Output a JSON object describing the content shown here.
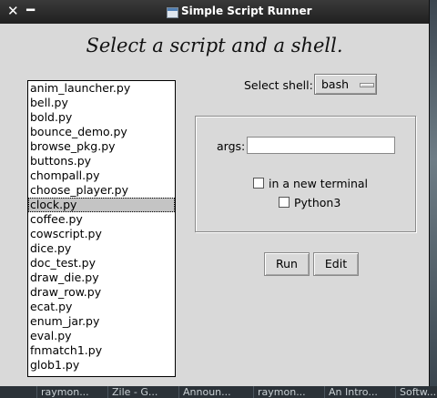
{
  "window": {
    "title": "Simple Script Runner",
    "close_glyph": "✕",
    "minimize_glyph": "━"
  },
  "heading": "Select a script and a shell.",
  "scripts": {
    "items": [
      "anim_launcher.py",
      "bell.py",
      "bold.py",
      "bounce_demo.py",
      "browse_pkg.py",
      "buttons.py",
      "chompall.py",
      "choose_player.py",
      "clock.py",
      "coffee.py",
      "cowscript.py",
      "dice.py",
      "doc_test.py",
      "draw_die.py",
      "draw_row.py",
      "ecat.py",
      "enum_jar.py",
      "eval.py",
      "fnmatch1.py",
      "glob1.py"
    ],
    "selected": "clock.py"
  },
  "shell": {
    "label": "Select shell:",
    "value": "bash"
  },
  "args": {
    "label": "args:",
    "value": ""
  },
  "options": {
    "new_terminal_label": "in a new terminal",
    "new_terminal_checked": false,
    "python3_label": "Python3",
    "python3_checked": false
  },
  "buttons": {
    "run_label": "Run",
    "edit_label": "Edit"
  },
  "taskbar": {
    "items": [
      "raymon...",
      "Zile - G...",
      "Announ...",
      "raymon...",
      "An Intro...",
      "Softw..."
    ]
  },
  "colors": {
    "window_bg": "#d9d9d9",
    "titlebar_bg": "#2a2a2a",
    "selected_item_bg": "#c4c4c4"
  }
}
